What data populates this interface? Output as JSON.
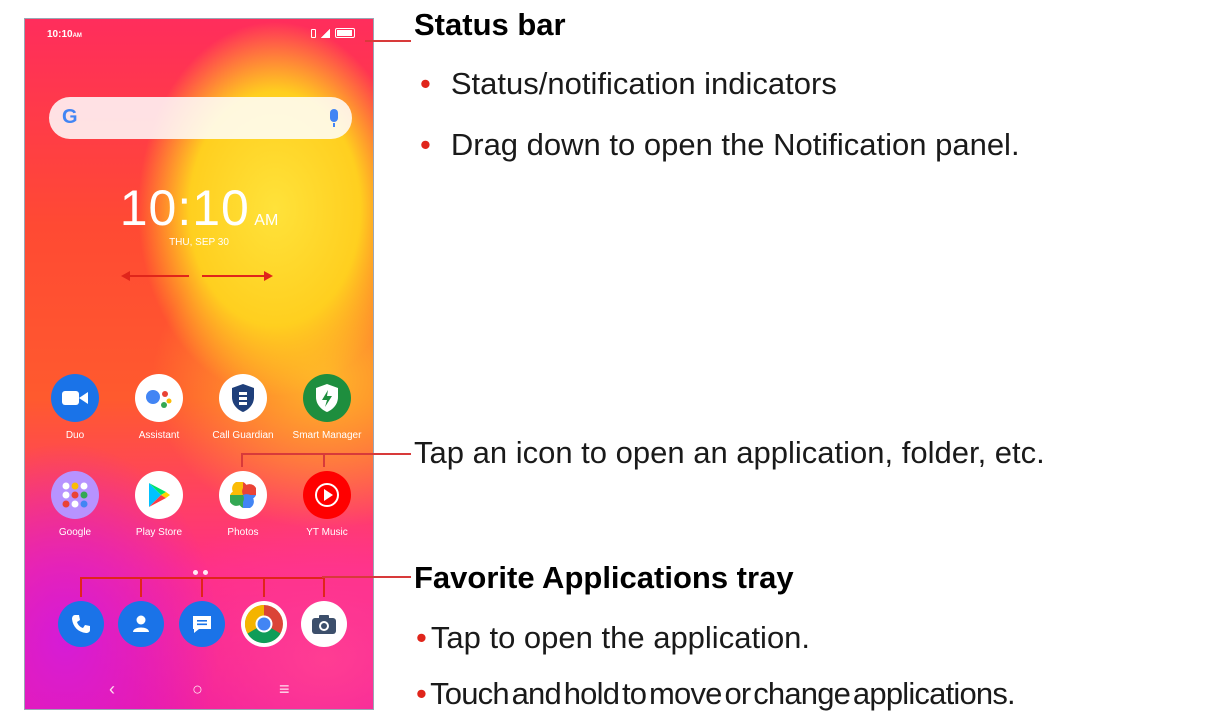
{
  "phone": {
    "status_bar": {
      "time": "10:10",
      "time_suffix": "AM"
    },
    "search": {
      "logo": "G",
      "mic_icon": "microphone-icon"
    },
    "clock": {
      "time": "10:10",
      "ampm": "AM",
      "date": "THU, SEP 30"
    },
    "apps_row1": [
      {
        "label": "Duo",
        "icon": "duo-video-icon",
        "color": "#1a73e8"
      },
      {
        "label": "Assistant",
        "icon": "google-assistant-icon",
        "color": "#ffffff"
      },
      {
        "label": "Call Guardian",
        "icon": "call-guardian-shield-icon",
        "color": "#ffffff"
      },
      {
        "label": "Smart Manager",
        "icon": "smart-manager-shield-icon",
        "color": "#1e8e3e"
      }
    ],
    "apps_row2": [
      {
        "label": "Google",
        "icon": "google-folder-icon",
        "color": "#b793ff"
      },
      {
        "label": "Play Store",
        "icon": "play-store-icon",
        "color": "#ffffff"
      },
      {
        "label": "Photos",
        "icon": "photos-pinwheel-icon",
        "color": "#ffffff"
      },
      {
        "label": "YT Music",
        "icon": "yt-music-icon",
        "color": "#ff0000"
      }
    ],
    "dock": [
      {
        "icon": "phone-icon"
      },
      {
        "icon": "contacts-icon"
      },
      {
        "icon": "messages-icon"
      },
      {
        "icon": "chrome-icon"
      },
      {
        "icon": "camera-icon"
      }
    ],
    "nav": {
      "back": "‹",
      "home": "○",
      "recents": "≡"
    }
  },
  "annotations": {
    "status_bar": {
      "heading": "Status bar",
      "bullets": [
        "Status/notification indicators",
        "Drag down to open the Notification panel."
      ]
    },
    "tap_icon": "Tap an icon to open an application, folder, etc.",
    "tray": {
      "heading": "Favorite Applications tray",
      "bullets": [
        "Tap to open the application.",
        "Touch and hold to move or change applications."
      ]
    }
  },
  "colors": {
    "accent": "#e0251b"
  }
}
